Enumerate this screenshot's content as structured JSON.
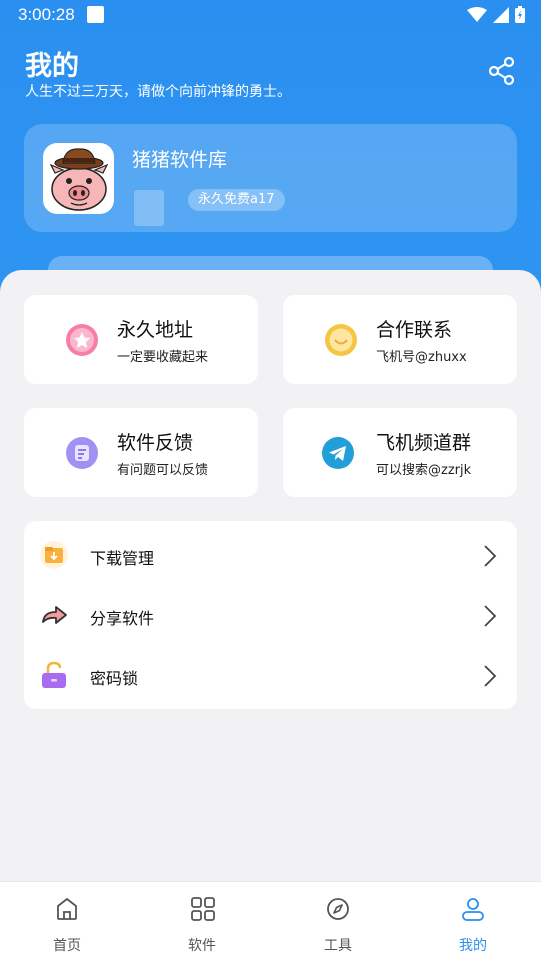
{
  "status": {
    "time": "3:00:28"
  },
  "header": {
    "title": "我的",
    "subtitle": "人生不过三万天，请做个向前冲锋的勇士。"
  },
  "profile": {
    "name": "猪猪软件库",
    "tag": "永久免费a17"
  },
  "grid": [
    {
      "title": "永久地址",
      "subtitle": "一定要收藏起来",
      "icon": "star-icon",
      "color": "#f06a9a"
    },
    {
      "title": "合作联系",
      "subtitle": "飞机号@zhuxx",
      "icon": "chat-icon",
      "color": "#f4c64a"
    },
    {
      "title": "软件反馈",
      "subtitle": "有问题可以反馈",
      "icon": "feedback-icon",
      "color": "#9b8cf0"
    },
    {
      "title": "飞机频道群",
      "subtitle": "可以搜索@zzrjk",
      "icon": "telegram-icon",
      "color": "#229ed9"
    }
  ],
  "list": [
    {
      "label": "下载管理",
      "icon": "download-folder-icon"
    },
    {
      "label": "分享软件",
      "icon": "share-arrow-icon"
    },
    {
      "label": "密码锁",
      "icon": "unlock-icon"
    }
  ],
  "tabs": [
    {
      "label": "首页",
      "icon": "home-icon"
    },
    {
      "label": "软件",
      "icon": "apps-grid-icon"
    },
    {
      "label": "工具",
      "icon": "compass-icon"
    },
    {
      "label": "我的",
      "icon": "user-icon",
      "active": true
    }
  ],
  "colors": {
    "primary": "#2a8ff0",
    "background": "#f2f2f4"
  }
}
